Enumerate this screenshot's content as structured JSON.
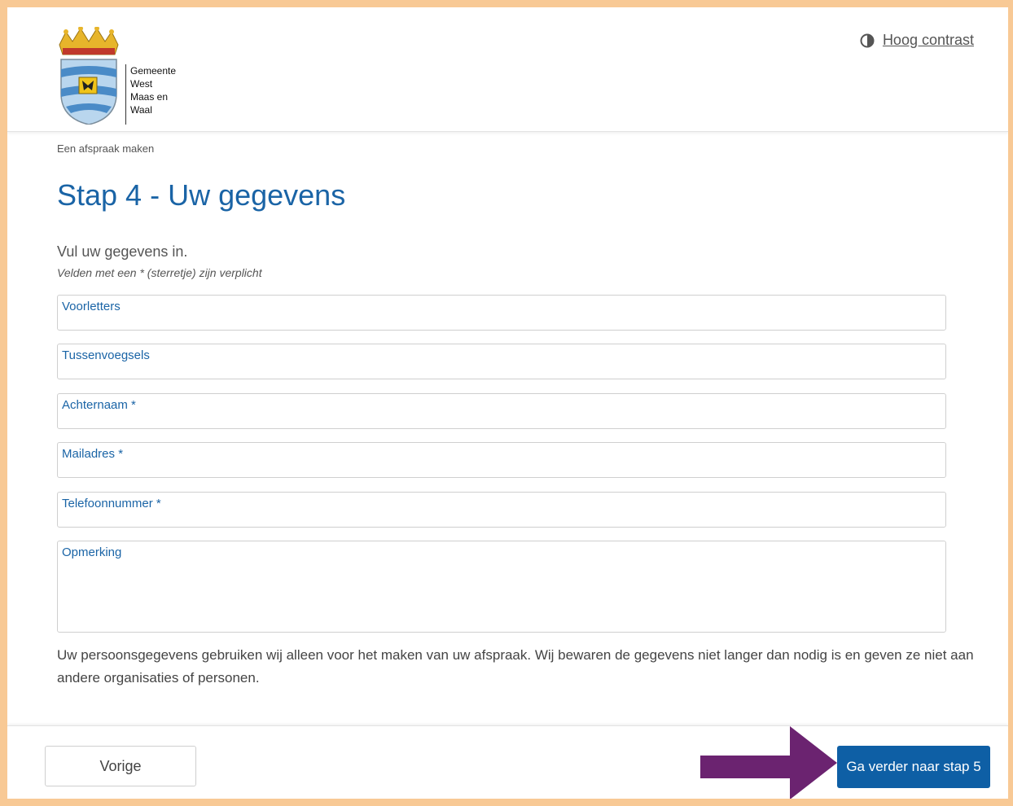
{
  "header": {
    "logo_lines": [
      "Gemeente",
      "West",
      "Maas en",
      "Waal"
    ],
    "contrast_label": "Hoog contrast"
  },
  "breadcrumb": "Een afspraak maken",
  "page_title": "Stap 4 - Uw gegevens",
  "intro": "Vul uw gegevens in.",
  "required_note": "Velden met een * (sterretje) zijn verplicht",
  "form": {
    "fields": [
      {
        "label": "Voorletters",
        "value": ""
      },
      {
        "label": "Tussenvoegsels",
        "value": ""
      },
      {
        "label": "Achternaam *",
        "value": ""
      },
      {
        "label": "Mailadres *",
        "value": ""
      },
      {
        "label": "Telefoonnummer *",
        "value": ""
      },
      {
        "label": "Opmerking",
        "value": ""
      }
    ]
  },
  "privacy_text": "Uw persoonsgegevens gebruiken wij alleen voor het maken van uw afspraak. Wij bewaren de gegevens niet langer dan nodig is en geven ze niet aan andere organisaties of personen.",
  "footer": {
    "prev_label": "Vorige",
    "next_label": "Ga verder naar stap 5"
  },
  "colors": {
    "page_border": "#f8c995",
    "brand_blue": "#1a64a6",
    "button_blue": "#0e5fa5",
    "annotation_arrow": "#6b2370"
  },
  "icons": {
    "contrast": "contrast-icon",
    "logo": "coat-of-arms-icon",
    "annotation": "arrow-right-icon"
  }
}
